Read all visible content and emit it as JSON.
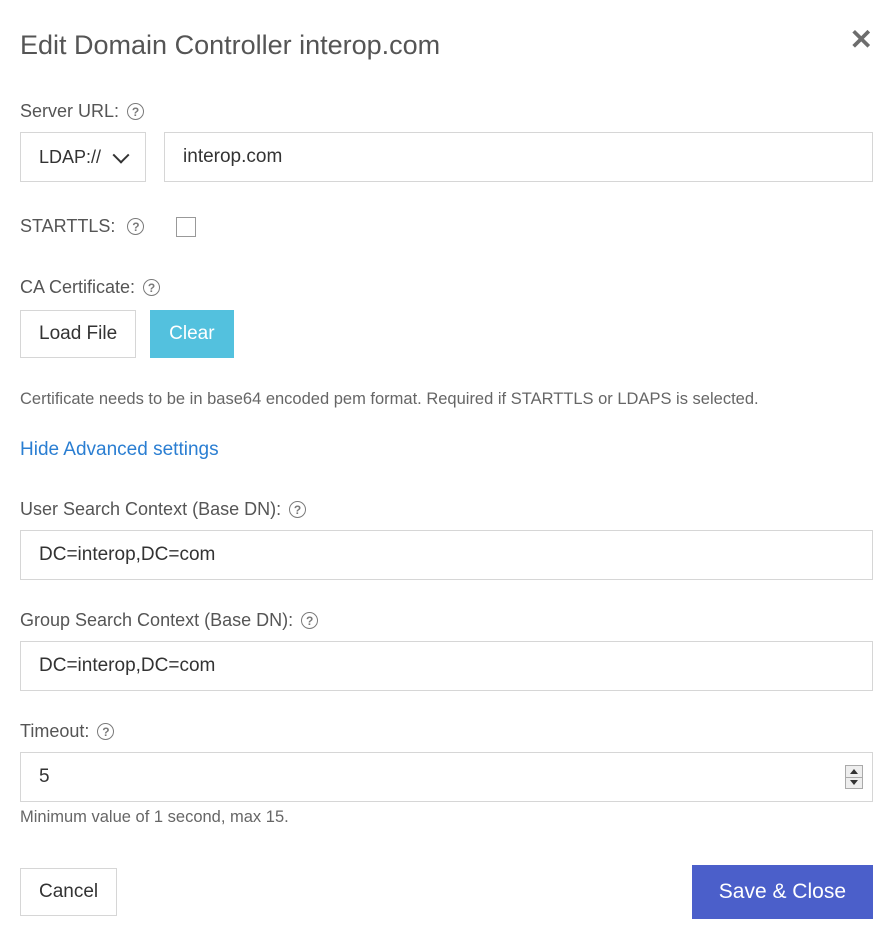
{
  "dialog": {
    "title": "Edit Domain Controller interop.com",
    "close_glyph": "✕"
  },
  "serverUrl": {
    "label": "Server URL:",
    "scheme_selected": "LDAP://",
    "host_value": "interop.com"
  },
  "starttls": {
    "label": "STARTTLS:",
    "checked": false
  },
  "caCert": {
    "label": "CA Certificate:",
    "load_btn": "Load File",
    "clear_btn": "Clear",
    "note": "Certificate needs to be in base64 encoded pem format. Required if STARTTLS or LDAPS is selected."
  },
  "advancedToggle": "Hide Advanced settings",
  "userSearch": {
    "label": "User Search Context (Base DN):",
    "value": "DC=interop,DC=com"
  },
  "groupSearch": {
    "label": "Group Search Context (Base DN):",
    "value": "DC=interop,DC=com"
  },
  "timeout": {
    "label": "Timeout:",
    "value": "5",
    "note": "Minimum value of 1 second, max 15."
  },
  "footer": {
    "cancel": "Cancel",
    "save": "Save & Close"
  }
}
